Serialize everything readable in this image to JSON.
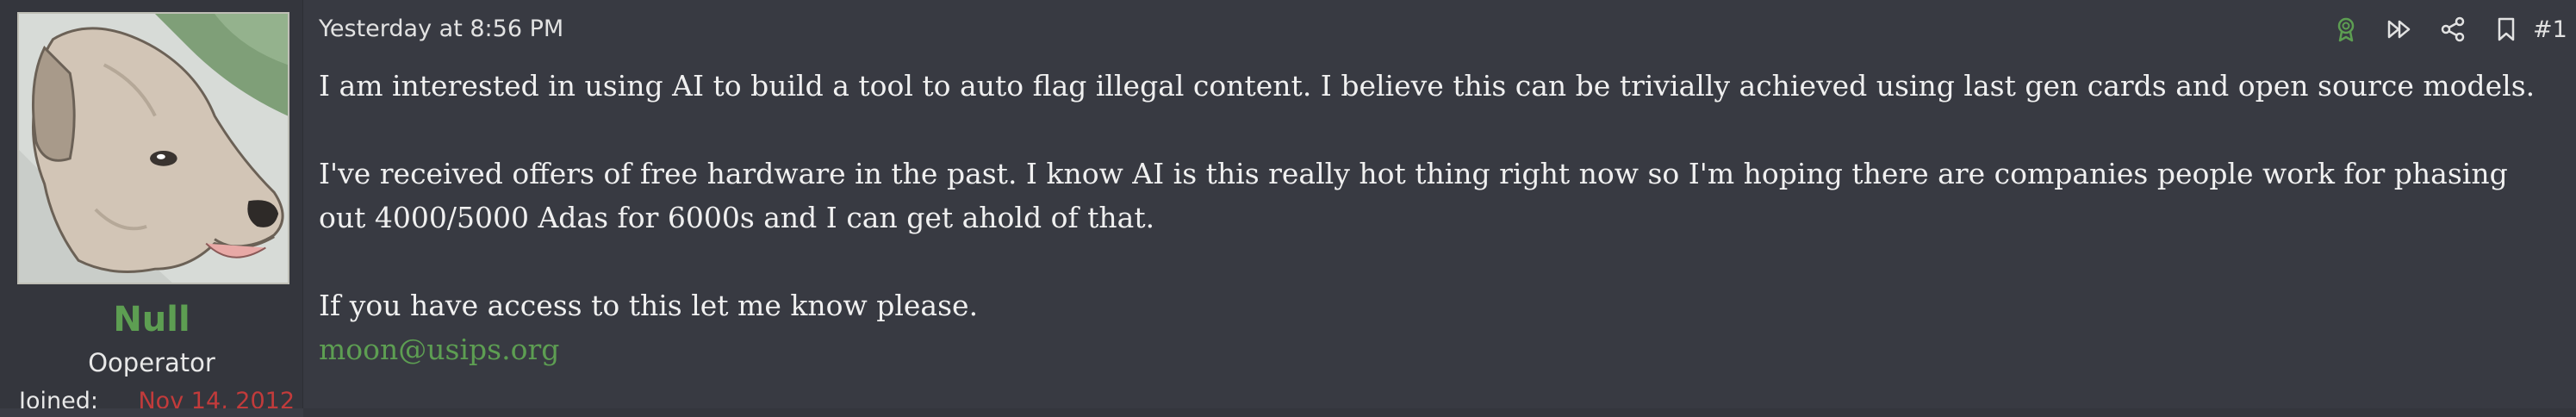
{
  "user": {
    "name": "Null",
    "title": "Ooperator",
    "joined_label": "Joined:",
    "joined_value": "Nov 14, 2012",
    "name_color": "#5d9e52"
  },
  "post": {
    "date": "Yesterday at 8:56 PM",
    "number": "#1",
    "paragraphs": [
      "I am interested in using AI to build a tool to auto flag illegal content. I believe this can be trivially achieved using last gen cards and open source models.",
      "I've received offers of free hardware in the past. I know AI is this really hot thing right now so I'm hoping there are companies people work for phasing out 4000/5000 Adas for 6000s and I can get ahold of that.",
      "If you have access to this let me know please."
    ],
    "signature": "moon@usips.org"
  },
  "actions": [
    {
      "name": "award-icon"
    },
    {
      "name": "fast-forward-icon"
    },
    {
      "name": "share-icon"
    },
    {
      "name": "bookmark-icon"
    }
  ]
}
